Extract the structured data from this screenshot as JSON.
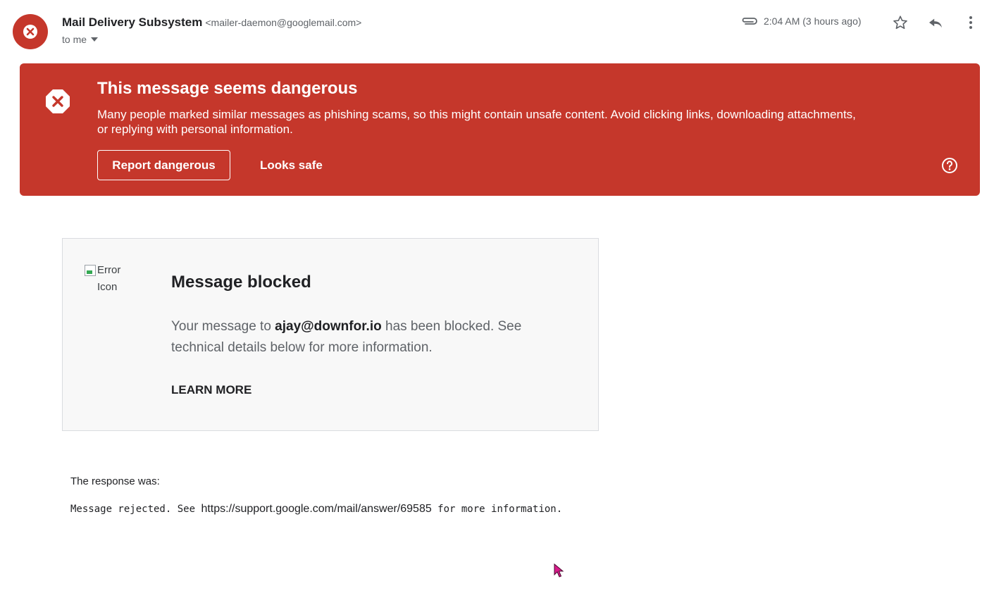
{
  "header": {
    "sender_name": "Mail Delivery Subsystem",
    "sender_email": "<mailer-daemon@googlemail.com>",
    "to_label": "to me",
    "time": "2:04 AM (3 hours ago)",
    "icons": {
      "avatar": "error-x-icon",
      "attachment": "paperclip-icon",
      "star": "star-icon",
      "reply": "reply-icon",
      "more": "more-vert-icon"
    }
  },
  "banner": {
    "title": "This message seems dangerous",
    "text": "Many people marked similar messages as phishing scams, so this might contain unsafe content. Avoid clicking links, downloading attachments, or replying with personal information.",
    "report_label": "Report dangerous",
    "safe_label": "Looks safe",
    "color": "#c5372b"
  },
  "card": {
    "img_alt": "Error Icon",
    "title": "Message blocked",
    "text_before": "Your message to ",
    "recipient": "ajay@downfor.io",
    "text_after": " has been blocked. See technical details below for more information.",
    "learn_more": "LEARN MORE"
  },
  "response": {
    "label": "The response was:",
    "text_before": "Message rejected. See ",
    "link": "https://support.google.com/mail/answer/69585",
    "text_after": " for more information."
  }
}
